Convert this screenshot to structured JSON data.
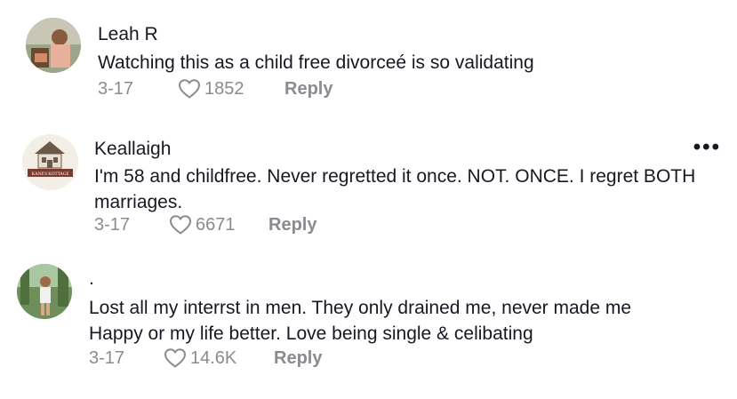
{
  "comments": [
    {
      "username": "Leah R",
      "text": "Watching this as a child free divorceé is so validating",
      "date": "3-17",
      "likes": "1852",
      "reply_label": "Reply",
      "avatar_icon": "avatar-photo"
    },
    {
      "username": "Keallaigh",
      "text": "I'm 58 and childfree. Never regretted it once. NOT. ONCE. I regret BOTH\nmarriages.",
      "date": "3-17",
      "likes": "6671",
      "reply_label": "Reply",
      "avatar_icon": "avatar-house-logo",
      "avatar_logo_text": "KANE'S KOTTAGE",
      "more_label": "•••"
    },
    {
      "username": ".",
      "text": "Lost all my interrst in men. They only drained me, never made me\nHappy or my life better. Love being single & celibating",
      "date": "3-17",
      "likes": "14.6K",
      "reply_label": "Reply",
      "avatar_icon": "avatar-photo"
    }
  ],
  "colors": {
    "text": "#161823",
    "meta": "#8a8b91"
  }
}
